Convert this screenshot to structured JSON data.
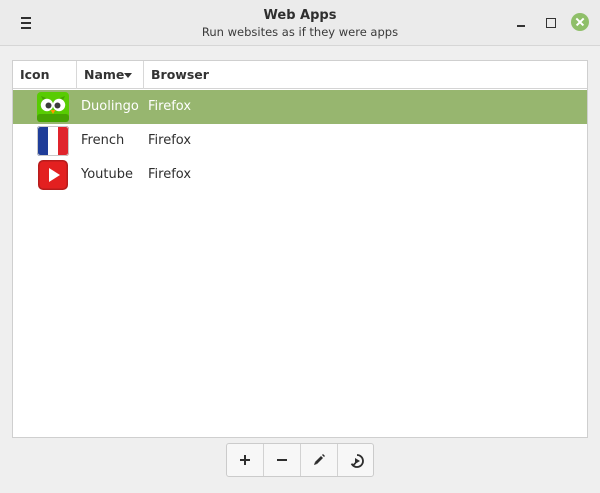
{
  "window": {
    "title": "Web Apps",
    "subtitle": "Run websites as if they were apps"
  },
  "columns": {
    "icon": "Icon",
    "name": "Name",
    "browser": "Browser",
    "sort_column": "name",
    "sort_order": "ascending"
  },
  "apps": [
    {
      "name": "Duolingo",
      "browser": "Firefox",
      "icon": "duolingo-owl-icon",
      "selected": true
    },
    {
      "name": "French",
      "browser": "Firefox",
      "icon": "french-flag-icon",
      "selected": false
    },
    {
      "name": "Youtube",
      "browser": "Firefox",
      "icon": "youtube-icon",
      "selected": false
    }
  ],
  "toolbar": {
    "buttons": [
      "add-icon",
      "remove-icon",
      "edit-pencil-icon",
      "launch-icon"
    ]
  },
  "colors": {
    "selection": "#97b66f",
    "close_button": "#8fbf69"
  }
}
